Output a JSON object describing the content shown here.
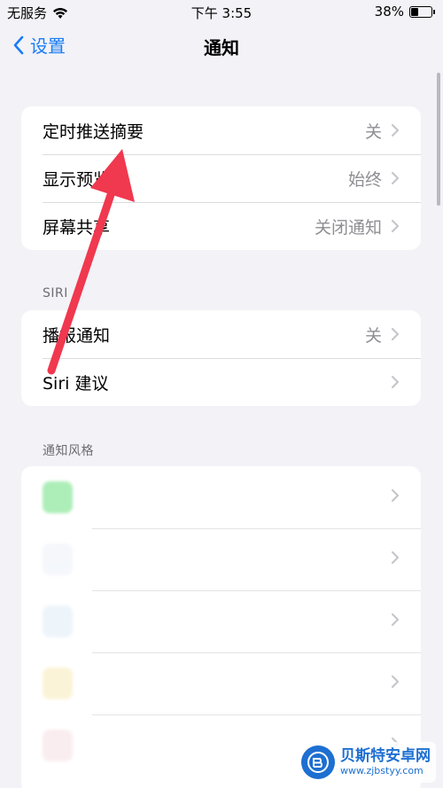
{
  "status_bar": {
    "carrier": "无服务",
    "time": "下午 3:55",
    "battery": "38%",
    "battery_level": 0.38
  },
  "nav": {
    "back_label": "设置",
    "title": "通知"
  },
  "group1": {
    "items": [
      {
        "label": "定时推送摘要",
        "value": "关"
      },
      {
        "label": "显示预览",
        "value": "始终"
      },
      {
        "label": "屏幕共享",
        "value": "关闭通知"
      }
    ]
  },
  "siri": {
    "header": "SIRI",
    "items": [
      {
        "label": "播报通知",
        "value": "关"
      },
      {
        "label": "Siri 建议",
        "value": ""
      }
    ]
  },
  "notification_style": {
    "header": "通知风格"
  },
  "watermark": {
    "title": "贝斯特安卓网",
    "url": "www.zjbstyy.com"
  },
  "colors": {
    "accent": "#1a7cf5",
    "arrow": "#f0384f",
    "background": "#f2f2f7"
  }
}
